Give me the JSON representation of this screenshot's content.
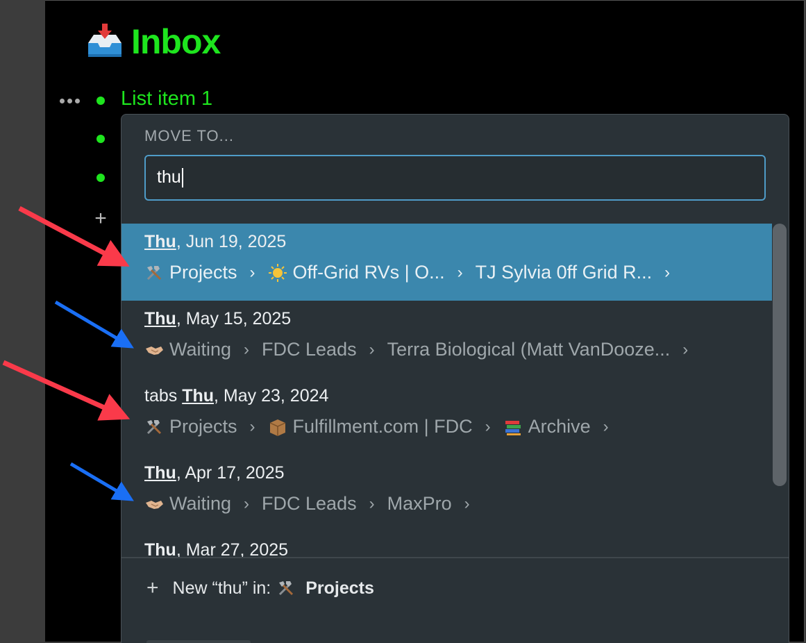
{
  "page": {
    "title": "Inbox",
    "icon": "inbox-tray-icon"
  },
  "list": {
    "items": [
      {
        "label": "List item 1"
      },
      {
        "label": ""
      },
      {
        "label": ""
      }
    ]
  },
  "popup": {
    "header": "MOVE TO...",
    "search_value": "thu",
    "results": [
      {
        "title_prefix": "",
        "title_highlight": "Thu",
        "title_rest": ", Jun 19, 2025",
        "path": [
          {
            "icon": "tools-icon",
            "label": "Projects"
          },
          {
            "icon": "sun-icon",
            "label": "Off-Grid RVs | O..."
          },
          {
            "icon": "",
            "label": "TJ Sylvia 0ff Grid R..."
          }
        ],
        "selected": true
      },
      {
        "title_prefix": "",
        "title_highlight": "Thu",
        "title_rest": ", May 15, 2025",
        "path": [
          {
            "icon": "handshake-icon",
            "label": "Waiting"
          },
          {
            "icon": "",
            "label": "FDC Leads"
          },
          {
            "icon": "",
            "label": "Terra Biological (Matt VanDooze..."
          }
        ],
        "selected": false
      },
      {
        "title_prefix": "tabs ",
        "title_highlight": "Thu",
        "title_rest": ", May 23, 2024",
        "path": [
          {
            "icon": "tools-icon",
            "label": "Projects"
          },
          {
            "icon": "package-icon",
            "label": "Fulfillment.com | FDC"
          },
          {
            "icon": "books-icon",
            "label": "Archive"
          }
        ],
        "selected": false
      },
      {
        "title_prefix": "",
        "title_highlight": "Thu",
        "title_rest": ", Apr 17, 2025",
        "path": [
          {
            "icon": "handshake-icon",
            "label": "Waiting"
          },
          {
            "icon": "",
            "label": "FDC Leads"
          },
          {
            "icon": "",
            "label": "MaxPro"
          }
        ],
        "selected": false
      },
      {
        "title_prefix": "",
        "title_highlight": "Thu",
        "title_rest": ", Mar 27, 2025",
        "path": [],
        "selected": false
      }
    ],
    "footer": {
      "new_label": "New “thu” in:",
      "target_icon": "tools-icon",
      "target": "Projects"
    }
  },
  "annotations": {
    "red": "#fa3a4a",
    "blue": "#1a6ff5"
  },
  "colors": {
    "accent_green": "#1ee51e",
    "selected_row": "#3b87ad",
    "popup_bg": "#2a3237"
  }
}
